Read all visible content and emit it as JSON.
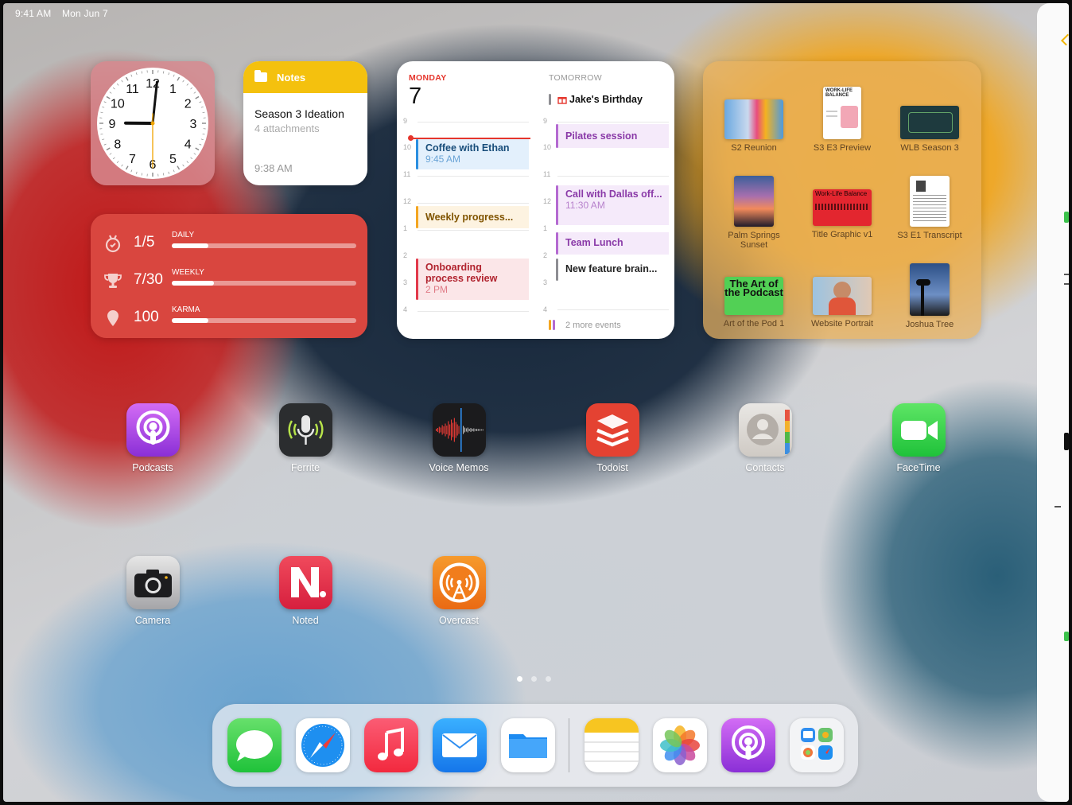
{
  "status_bar": {
    "time": "9:41 AM",
    "date": "Mon Jun 7"
  },
  "notes_widget": {
    "app_label": "Notes",
    "note_title": "Season 3 Ideation",
    "attachments": "4 attachments",
    "time": "9:38 AM"
  },
  "clock_widget": {
    "numbers": [
      "12",
      "1",
      "2",
      "3",
      "4",
      "5",
      "6",
      "7",
      "8",
      "9",
      "10",
      "11"
    ],
    "hour_hand": "9:01",
    "minute_hand_min": 1,
    "second_hand_sec": 30
  },
  "fitness_widget": {
    "rows": [
      {
        "value": "1/5",
        "label": "DAILY",
        "progress": 0.2
      },
      {
        "value": "7/30",
        "label": "WEEKLY",
        "progress": 0.23
      },
      {
        "value": "100",
        "label": "KARMA",
        "progress": 0.2
      }
    ]
  },
  "calendar_widget": {
    "today_label": "MONDAY",
    "today_date": "7",
    "tomorrow_label": "TOMORROW",
    "hours_left": [
      "9",
      "10",
      "11",
      "12",
      "1",
      "2",
      "3",
      "4"
    ],
    "hours_right": [
      "9",
      "10",
      "11",
      "12",
      "1",
      "2",
      "3",
      "4"
    ],
    "today_events": [
      {
        "title": "Coffee with Ethan",
        "time": "9:45 AM",
        "color": "#2b8fe0"
      },
      {
        "title": "Weekly progress...",
        "time": "",
        "color": "#f4a621"
      },
      {
        "title": "Onboarding process review",
        "time": "2 PM",
        "color": "#e23a4b"
      }
    ],
    "allday_event": {
      "title": "Jake's Birthday"
    },
    "tomorrow_events": [
      {
        "title": "Pilates session",
        "time": "",
        "color": "#b46ad1"
      },
      {
        "title": "Call with Dallas off...",
        "time": "11:30 AM",
        "color": "#b46ad1"
      },
      {
        "title": "Team Lunch",
        "time": "",
        "color": "#b46ad1"
      },
      {
        "title": "New feature brain...",
        "time": "",
        "color": "#8e8e93"
      }
    ],
    "more_events": "2 more events"
  },
  "photos_widget": {
    "items": [
      {
        "caption": "S2 Reunion"
      },
      {
        "caption": "S3 E3 Preview"
      },
      {
        "caption": "WLB Season 3"
      },
      {
        "caption": "Palm Springs Sunset"
      },
      {
        "caption": "Title Graphic v1"
      },
      {
        "caption": "S3 E1 Transcript"
      },
      {
        "caption": "Art of the Pod 1"
      },
      {
        "caption": "Website Portrait"
      },
      {
        "caption": "Joshua Tree"
      }
    ],
    "thumb_text": {
      "worklife": "WORK-LIFE BALANCE",
      "art_of_podcast": "The Art of the Podcast",
      "title_graphic": "Work-Life Balance"
    }
  },
  "apps_row1": [
    "Podcasts",
    "Ferrite",
    "Voice Memos",
    "Todoist",
    "Contacts",
    "FaceTime"
  ],
  "apps_row2": [
    "Camera",
    "Noted",
    "Overcast"
  ],
  "page_dots": {
    "count": 3,
    "active": 0
  },
  "dock": [
    "Messages",
    "Safari",
    "Music",
    "Mail",
    "Files",
    "Notes",
    "Photos",
    "Podcasts",
    "App Library"
  ],
  "colors": {
    "fitness_bg": "#d9463f",
    "notes_header": "#f4c10e",
    "calendar_red": "#e5362d"
  }
}
